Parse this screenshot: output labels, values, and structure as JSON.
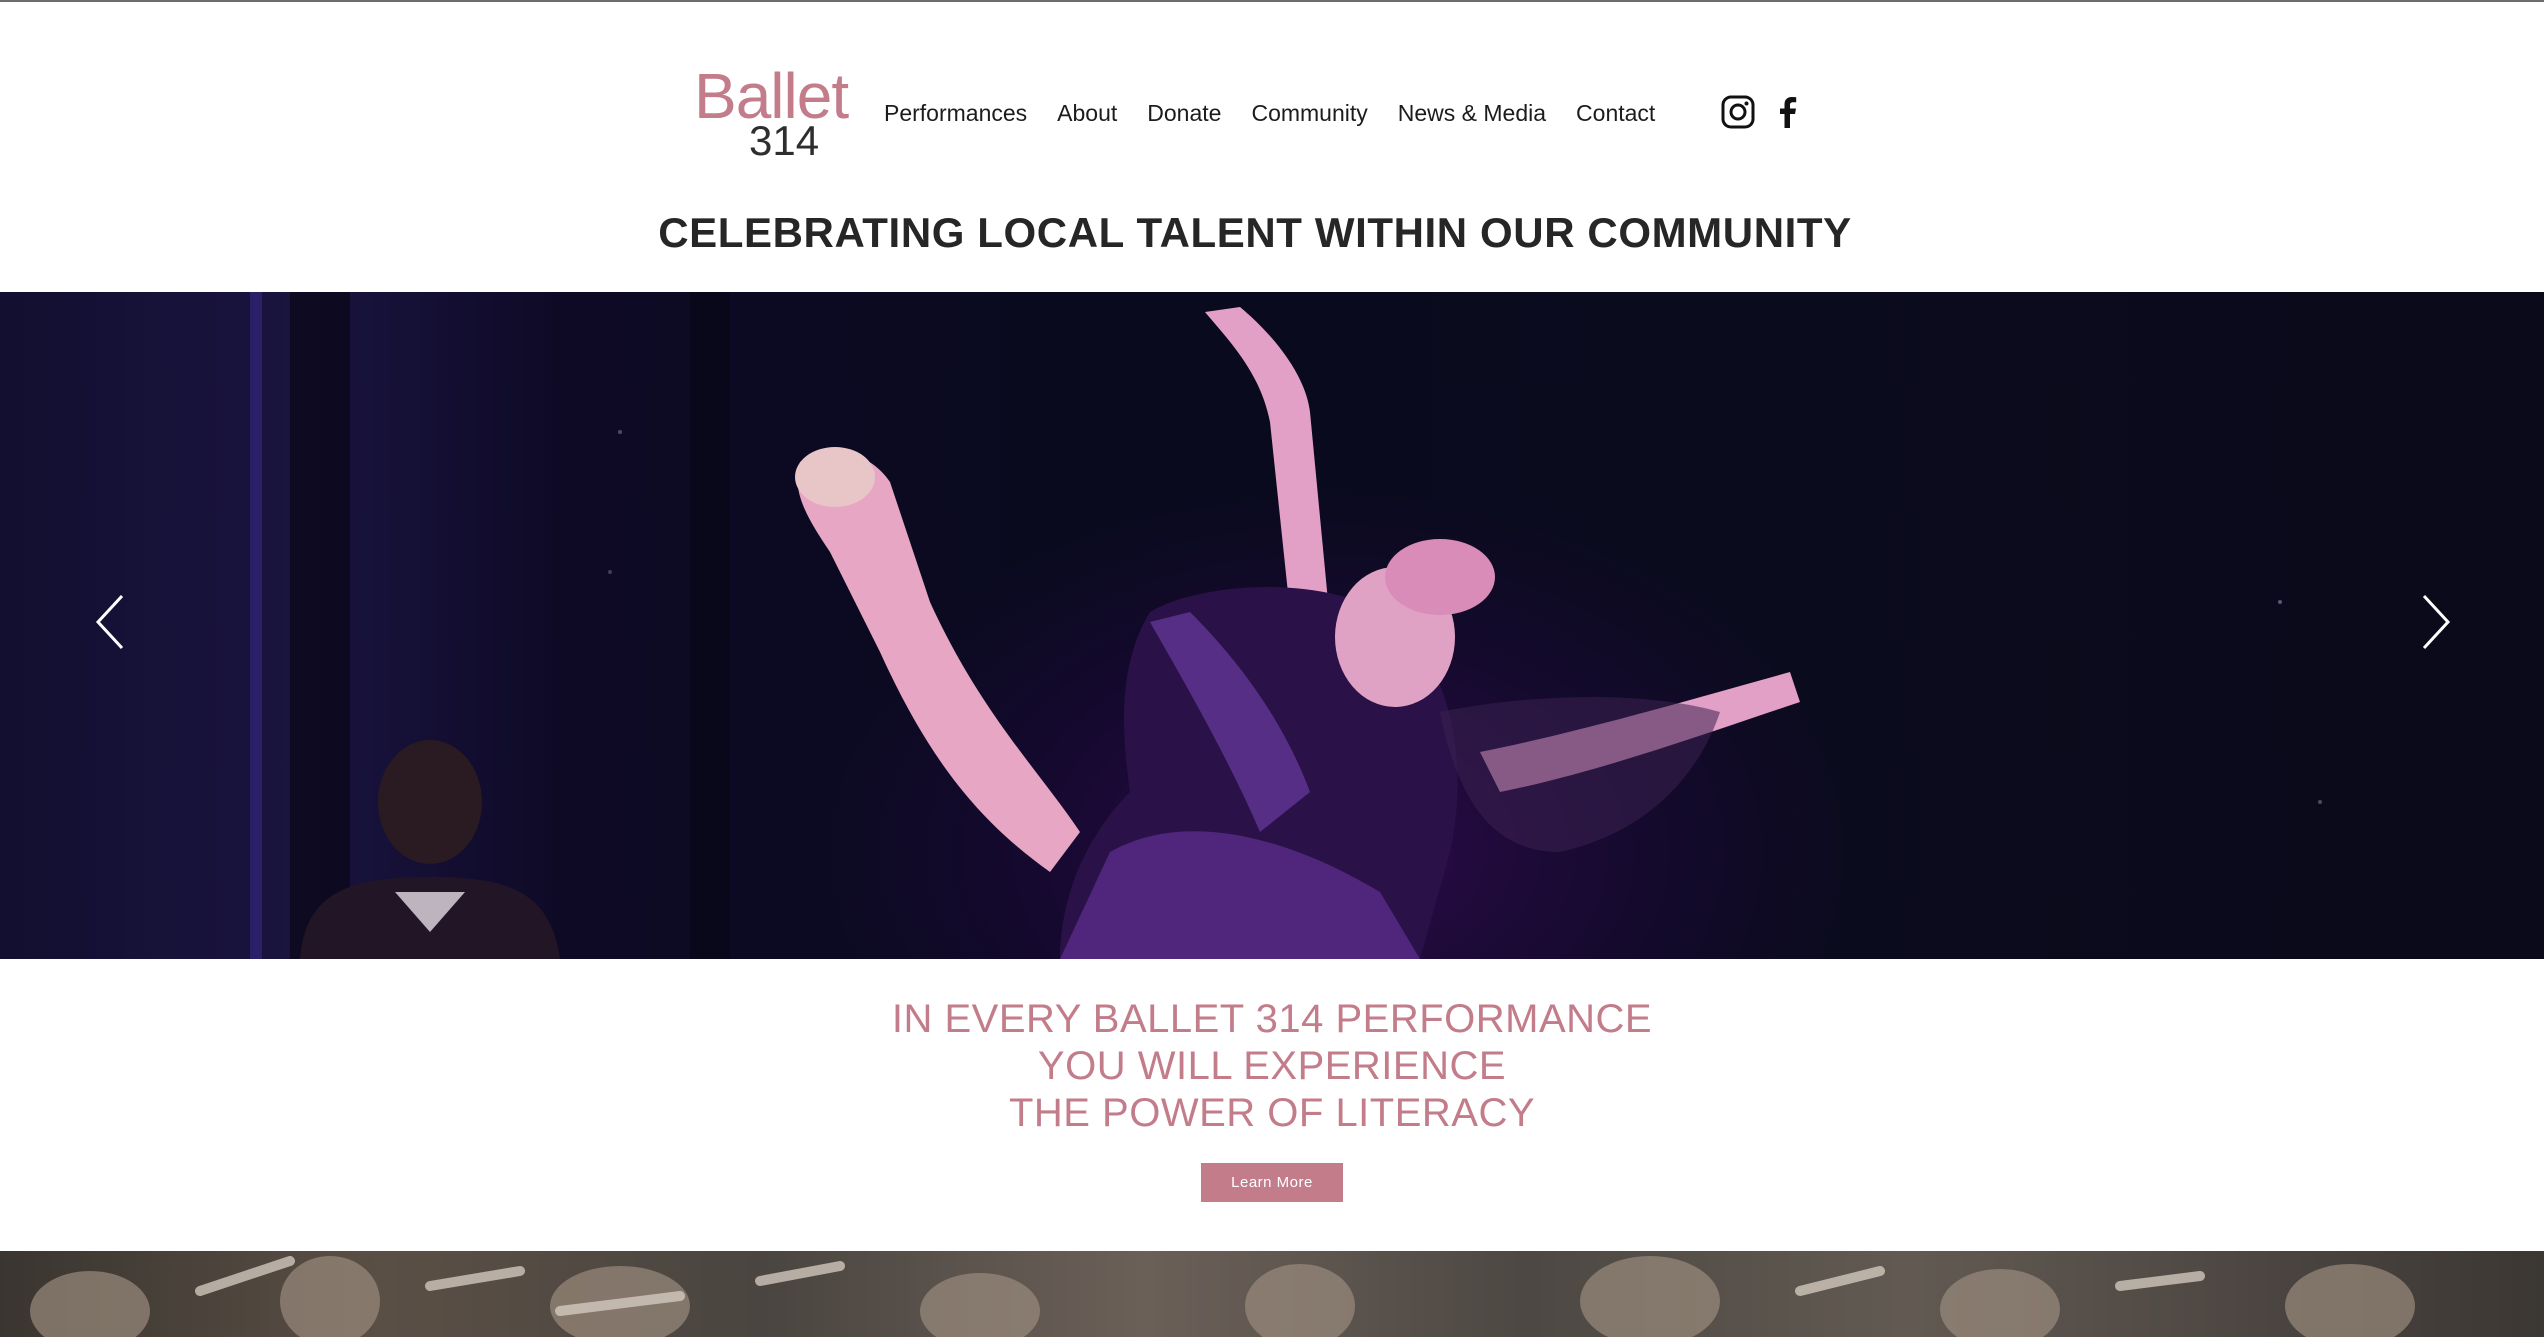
{
  "logo": {
    "line1": "Ballet",
    "line2": "314"
  },
  "nav": {
    "items": [
      "Performances",
      "About",
      "Donate",
      "Community",
      "News & Media",
      "Contact"
    ]
  },
  "social": {
    "icons": [
      "instagram-icon",
      "facebook-icon"
    ]
  },
  "headline": "CELEBRATING LOCAL TALENT WITHIN OUR COMMUNITY",
  "hero": {
    "prev_icon": "chevron-left-icon",
    "next_icon": "chevron-right-icon"
  },
  "tagline": {
    "line1": "IN EVERY BALLET 314 PERFORMANCE",
    "line2": "YOU WILL EXPERIENCE",
    "line3": "THE POWER OF LITERACY"
  },
  "cta": {
    "label": "Learn More"
  },
  "colors": {
    "brand": "#c27c8a",
    "text": "#262626"
  }
}
